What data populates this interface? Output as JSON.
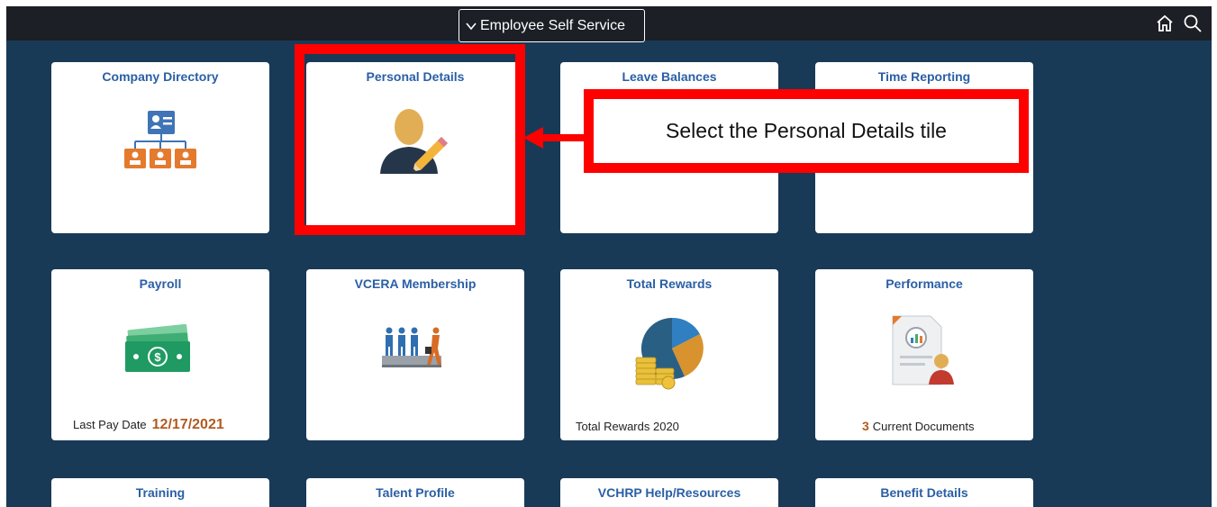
{
  "header": {
    "title": "Employee Self Service",
    "icons": [
      "chevron-down-icon",
      "home-icon",
      "search-icon"
    ]
  },
  "tiles": {
    "company_directory": {
      "title": "Company Directory",
      "icon": "org-chart-icon"
    },
    "personal_details": {
      "title": "Personal Details",
      "icon": "person-edit-icon"
    },
    "leave_balances": {
      "title": "Leave Balances"
    },
    "time_reporting": {
      "title": "Time Reporting"
    },
    "payroll": {
      "title": "Payroll",
      "icon": "money-icon",
      "footer_label": "Last Pay Date",
      "footer_value": "12/17/2021"
    },
    "vcera_membership": {
      "title": "VCERA Membership",
      "icon": "retirement-icon"
    },
    "total_rewards": {
      "title": "Total Rewards",
      "icon": "pie-coins-icon",
      "footer_label": "Total Rewards 2020"
    },
    "performance": {
      "title": "Performance",
      "icon": "document-chart-icon",
      "footer_value": "3",
      "footer_label": "Current Documents"
    },
    "training": {
      "title": "Training"
    },
    "talent_profile": {
      "title": "Talent Profile"
    },
    "vchrp_help": {
      "title": "VCHRP Help/Resources"
    },
    "benefit_details": {
      "title": "Benefit Details"
    }
  },
  "annotation": {
    "callout_text": "Select the Personal Details tile"
  },
  "colors": {
    "background": "#183a57",
    "topbar": "#1c1f26",
    "tile_title": "#2a5fa5",
    "highlight": "#ff0000",
    "accent_value": "#b05b20"
  }
}
